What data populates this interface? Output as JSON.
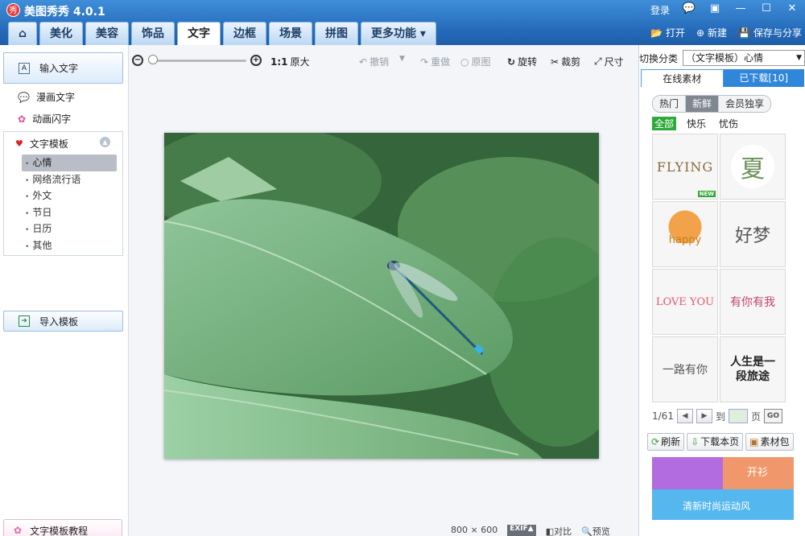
{
  "app": {
    "title": "美图秀秀 4.0.1",
    "logo_char": "秀",
    "login": "登录"
  },
  "window_buttons": [
    "💬",
    "▣",
    "—",
    "☐",
    "✕"
  ],
  "tabs": [
    "美化",
    "美容",
    "饰品",
    "文字",
    "边框",
    "场景",
    "拼图",
    "更多功能 ▾"
  ],
  "tab_home_icon": "⌂",
  "right_tools": {
    "open": "打开",
    "new": "新建",
    "save": "保存与分享"
  },
  "left": {
    "input_text": "输入文字",
    "comic_text": "漫画文字",
    "anim_text": "动画闪字",
    "template_header": "文字模板",
    "template_items": [
      "心情",
      "网络流行语",
      "外文",
      "节日",
      "日历",
      "其他"
    ],
    "import_template": "导入模板",
    "tutorial": "文字模板教程"
  },
  "toolbar": {
    "ratio": "1:1",
    "original_size": "原大",
    "undo": "撤销",
    "redo": "重做",
    "original": "原图",
    "rotate": "旋转",
    "crop": "裁剪",
    "resize": "尺寸"
  },
  "status": {
    "size": "800 × 600",
    "exif": "EXIF▲",
    "compare": "对比",
    "preview": "预览"
  },
  "right": {
    "switch_label": "切换分类",
    "category_selected": "（文字模板）心情",
    "tab_online": "在线素材",
    "tab_downloaded": "已下载[10]",
    "seg_buttons": [
      "热门",
      "新鲜",
      "会员独享"
    ],
    "filters": [
      "全部",
      "快乐",
      "忧伤"
    ],
    "stickers": [
      {
        "text": "FLYING",
        "badge": "NEW",
        "color": "#8a6a3a"
      },
      {
        "text": "夏",
        "badge": "",
        "color": "#6b8f56"
      },
      {
        "text": "happy",
        "badge": "",
        "color": "#c77b1c"
      },
      {
        "text": "好梦",
        "badge": "",
        "color": "#555555"
      },
      {
        "text": "LOVE YOU",
        "badge": "",
        "color": "#e05a6e"
      },
      {
        "text": "有你有我",
        "badge": "",
        "color": "#c0456a"
      },
      {
        "text": "一路有你",
        "badge": "",
        "color": "#555555"
      },
      {
        "text": "人生是一段旅途",
        "badge": "",
        "color": "#222222"
      }
    ],
    "page_info": "1/61",
    "goto_label": "到",
    "page_unit": "页",
    "go": "GO",
    "refresh": "刷新",
    "download_page": "下载本页",
    "material_pack": "素材包",
    "banner_texts": [
      "开衫",
      "清新时尚运动风"
    ]
  },
  "colors": {
    "accent": "#2f86da",
    "title_bg": "#2469b8",
    "green": "#2fa93a"
  }
}
